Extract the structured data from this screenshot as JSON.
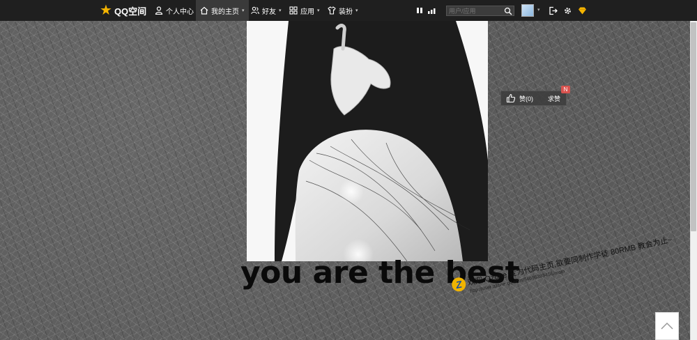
{
  "nav": {
    "logo_text": "QQ空间",
    "items": [
      {
        "label": "个人中心",
        "icon": "person-icon"
      },
      {
        "label": "我的主页",
        "icon": "home-icon",
        "has_caret": true
      },
      {
        "label": "好友",
        "icon": "friends-icon",
        "has_caret": true
      },
      {
        "label": "应用",
        "icon": "apps-icon",
        "has_caret": true
      },
      {
        "label": "装扮",
        "icon": "shirt-icon",
        "has_caret": true
      }
    ],
    "search_placeholder": "用户/应用"
  },
  "headline": "you are the best",
  "like_widget": {
    "like_label": "赞(0)",
    "ask_label": "求赞",
    "badge": "N"
  },
  "banner": {
    "line1": "欢迎 Qzone 变为代码主页,欲要同制作学徒 80RMB 教会为止~",
    "line2": "http://user.qzone.qq.com/54695383456/main"
  },
  "colors": {
    "topbar": "#1f1f1f",
    "logo_star": "#f4b400",
    "badge": "#d9534f"
  }
}
